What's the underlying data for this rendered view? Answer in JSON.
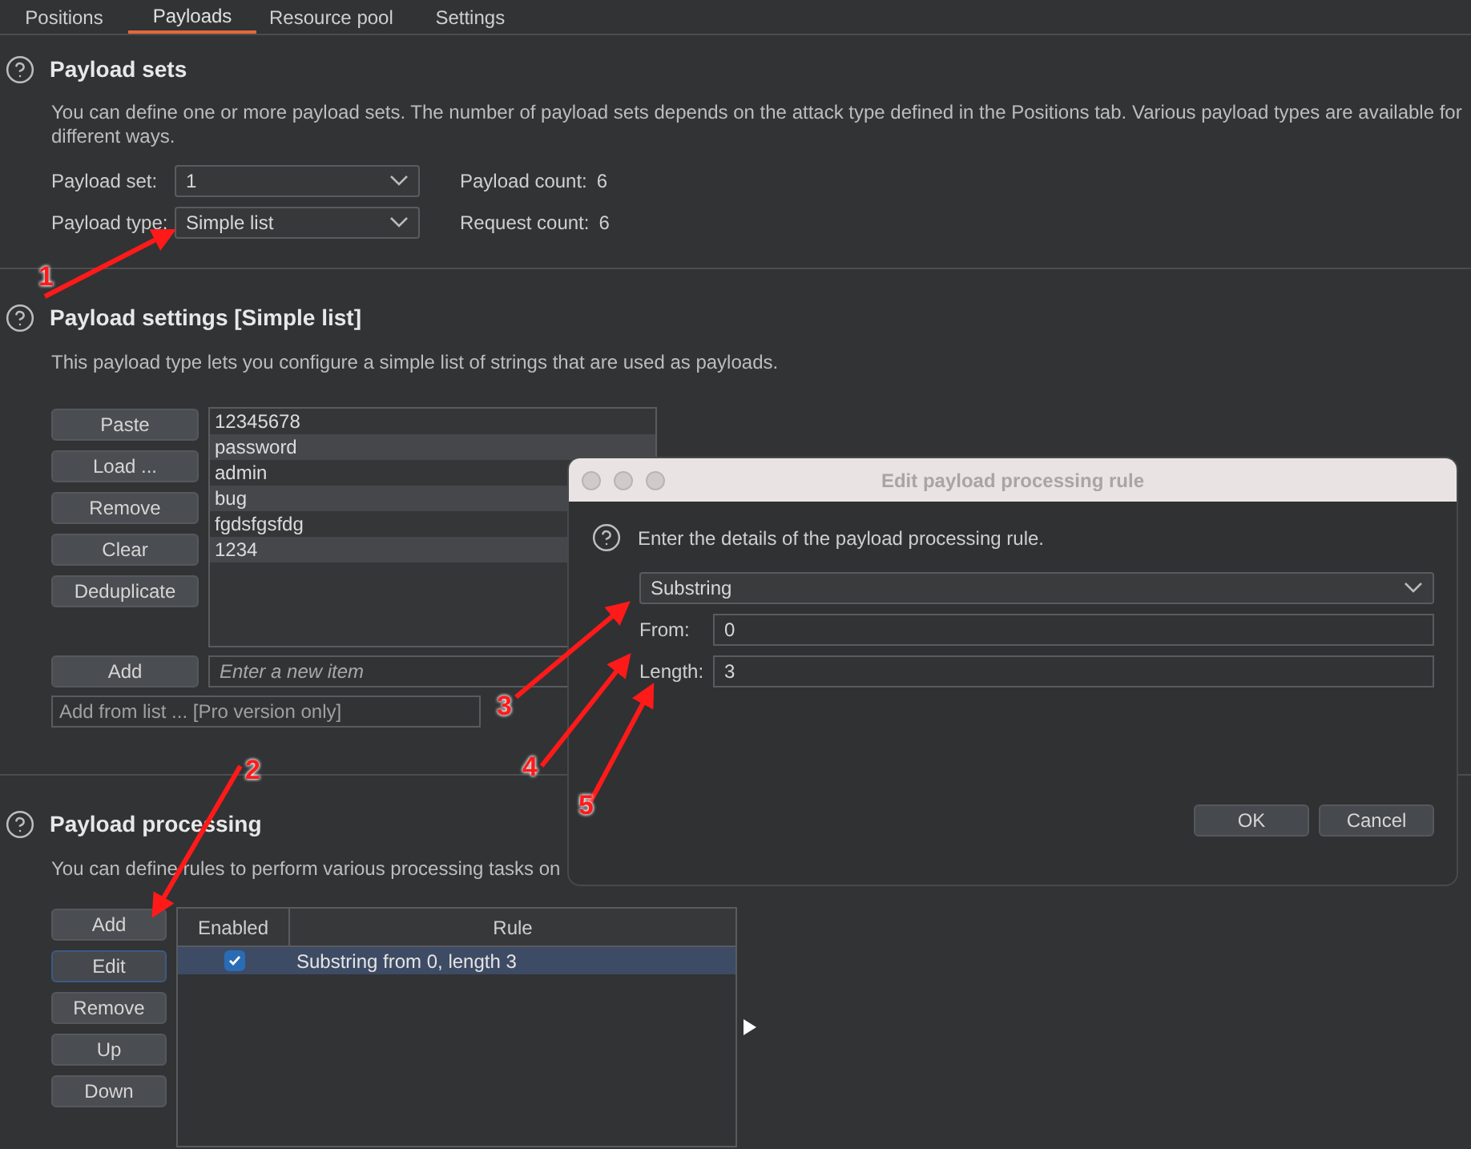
{
  "tabs": [
    {
      "label": "Positions",
      "selected": false
    },
    {
      "label": "Payloads",
      "selected": true
    },
    {
      "label": "Resource pool",
      "selected": false
    },
    {
      "label": "Settings",
      "selected": false
    }
  ],
  "payload_sets": {
    "title": "Payload sets",
    "description_lines": [
      "You can define one or more payload sets. The number of payload sets depends on the attack type defined in the Positions tab. Various payload types are available for",
      "different ways."
    ],
    "payload_set": {
      "label": "Payload set:",
      "value": "1"
    },
    "payload_type": {
      "label": "Payload type:",
      "value": "Simple list"
    },
    "payload_count": {
      "label": "Payload count:",
      "value": "6"
    },
    "request_count": {
      "label": "Request count:",
      "value": "6"
    }
  },
  "payload_settings": {
    "title": "Payload settings [Simple list]",
    "description": "This payload type lets you configure a simple list of strings that are used as payloads.",
    "buttons": [
      "Paste",
      "Load ...",
      "Remove",
      "Clear",
      "Deduplicate"
    ],
    "items": [
      "12345678",
      "password",
      "admin",
      "bug",
      "fgdsfgsfdg",
      "1234"
    ],
    "add_button": "Add",
    "new_item": {
      "placeholder": "Enter a new item"
    },
    "add_from_list": {
      "placeholder": "Add from list ... [Pro version only]"
    }
  },
  "payload_processing": {
    "title": "Payload processing",
    "description": "You can define rules to perform various processing tasks on",
    "buttons": [
      {
        "label": "Add",
        "selected": false
      },
      {
        "label": "Edit",
        "selected": true
      },
      {
        "label": "Remove",
        "selected": false
      },
      {
        "label": "Up",
        "selected": false
      },
      {
        "label": "Down",
        "selected": false
      }
    ],
    "table": {
      "columns": [
        "Enabled",
        "Rule"
      ],
      "rows": [
        {
          "enabled": true,
          "rule": "Substring from 0, length 3",
          "selected": true
        }
      ]
    }
  },
  "dialog": {
    "title": "Edit payload processing rule",
    "prompt": "Enter the details of the payload processing rule.",
    "rule_type": "Substring",
    "from": {
      "label": "From:",
      "value": "0"
    },
    "length": {
      "label": "Length:",
      "value": "3"
    },
    "buttons": [
      "OK",
      "Cancel"
    ]
  },
  "annotations": [
    "1",
    "2",
    "3",
    "4",
    "5"
  ]
}
